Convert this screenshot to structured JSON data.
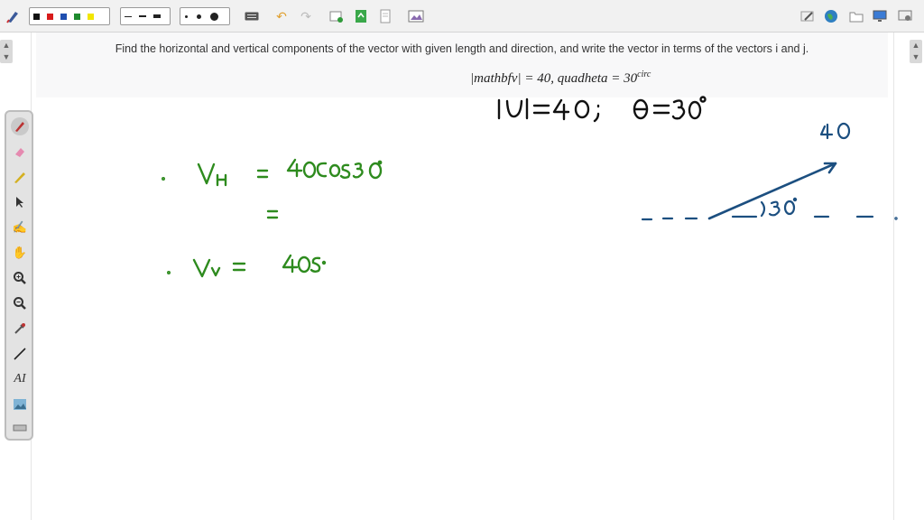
{
  "toolbar": {
    "colors": [
      "#111111",
      "#d81b1b",
      "#1f4fb0",
      "#1e8a2e",
      "#f2e600"
    ],
    "line_styles": [
      "dashed-thin",
      "dashed-medium",
      "solid-thick"
    ],
    "dot_sizes": [
      "small",
      "medium",
      "large"
    ],
    "icons_left": [
      "pen-logo-icon",
      "keyboard-icon",
      "undo-icon",
      "redo-icon",
      "add-page-icon",
      "export-icon",
      "document-icon",
      "image-icon"
    ],
    "icons_right": [
      "edit-page-icon",
      "globe-icon",
      "folder-icon",
      "monitor-icon",
      "settings-icon"
    ]
  },
  "question": {
    "text": "Find the horizontal and vertical components of the vector with given length and direction, and write the vector in terms of the vectors i and j.",
    "formula_main": "|mathbfv| = 40, quadheta = 30",
    "formula_sup": "circ"
  },
  "palette": {
    "tools": [
      "pen-icon",
      "eraser-icon",
      "highlighter-icon",
      "pointer-icon",
      "hand-point-icon",
      "hand-pan-icon",
      "zoom-in-icon",
      "zoom-out-icon",
      "eyedropper-icon",
      "line-icon",
      "text-tool-icon",
      "image-tool-icon",
      "ruler-icon"
    ],
    "text_tool_label": "AI"
  },
  "ink_colors": {
    "black": "#111111",
    "green": "#2e8b1e",
    "blue": "#1c4f80"
  }
}
